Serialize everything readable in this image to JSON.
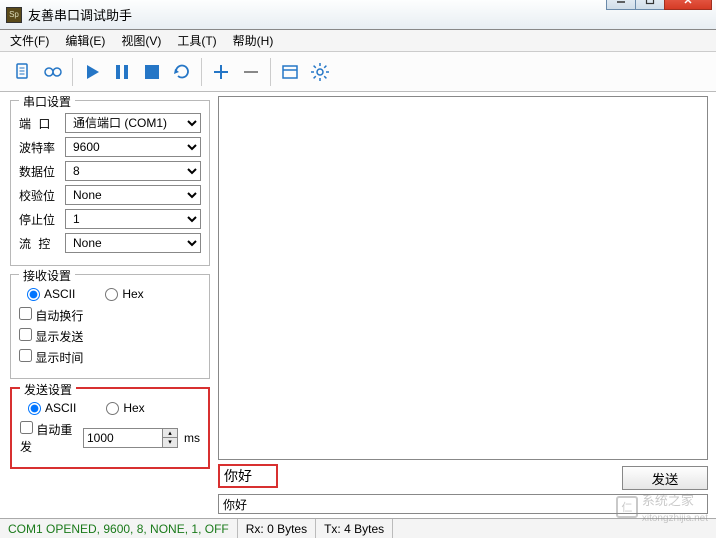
{
  "window": {
    "title": "友善串口调试助手"
  },
  "menu": {
    "file": "文件(F)",
    "edit": "编辑(E)",
    "view": "视图(V)",
    "tools": "工具(T)",
    "help": "帮助(H)"
  },
  "serial": {
    "legend": "串口设置",
    "port_label": "端  口",
    "port_value": "通信端口 (COM1)",
    "baud_label": "波特率",
    "baud_value": "9600",
    "data_label": "数据位",
    "data_value": "8",
    "parity_label": "校验位",
    "parity_value": "None",
    "stop_label": "停止位",
    "stop_value": "1",
    "flow_label": "流  控",
    "flow_value": "None"
  },
  "recv": {
    "legend": "接收设置",
    "ascii": "ASCII",
    "hex": "Hex",
    "autowrap": "自动换行",
    "showsend": "显示发送",
    "showtime": "显示时间"
  },
  "send": {
    "legend": "发送设置",
    "ascii": "ASCII",
    "hex": "Hex",
    "autorepeat": "自动重发",
    "interval": "1000",
    "unit": "ms"
  },
  "tx": {
    "text": "你好",
    "echo": "你好",
    "send_btn": "发送"
  },
  "status": {
    "conn": "COM1 OPENED, 9600, 8, NONE, 1, OFF",
    "rx": "Rx: 0 Bytes",
    "tx": "Tx: 4 Bytes"
  },
  "watermark": {
    "brand": "系统之家",
    "url": "xitongzhijia.net"
  }
}
